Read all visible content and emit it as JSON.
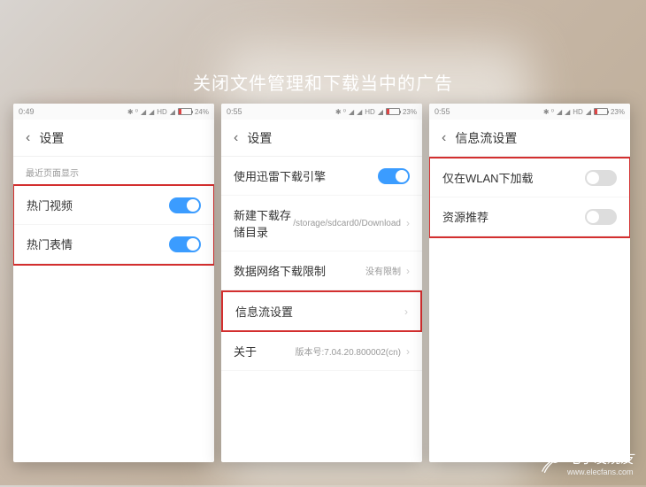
{
  "title": "关闭文件管理和下载当中的广告",
  "phone1": {
    "time": "0:49",
    "battery_pct": "24%",
    "battery_fill": "24%",
    "header": "设置",
    "section": "最近页面显示",
    "rows": [
      {
        "label": "热门视频",
        "toggle": "on"
      },
      {
        "label": "热门表情",
        "toggle": "on"
      }
    ]
  },
  "phone2": {
    "time": "0:55",
    "battery_pct": "23%",
    "battery_fill": "23%",
    "header": "设置",
    "rows": [
      {
        "label": "使用迅雷下载引擎",
        "toggle": "on"
      },
      {
        "label": "新建下载存储目录",
        "value": "/storage/sdcard0/Download"
      },
      {
        "label": "数据网络下载限制",
        "value": "没有限制"
      },
      {
        "label": "信息流设置",
        "highlight": true
      },
      {
        "label": "关于",
        "value": "版本号:7.04.20.800002(cn)"
      }
    ]
  },
  "phone3": {
    "time": "0:55",
    "battery_pct": "23%",
    "battery_fill": "23%",
    "header": "信息流设置",
    "rows": [
      {
        "label": "仅在WLAN下加载",
        "toggle": "off"
      },
      {
        "label": "资源推荐",
        "toggle": "off"
      }
    ]
  },
  "watermark": {
    "name": "电子发烧友",
    "url": "www.elecfans.com"
  },
  "status_icons": "HD"
}
